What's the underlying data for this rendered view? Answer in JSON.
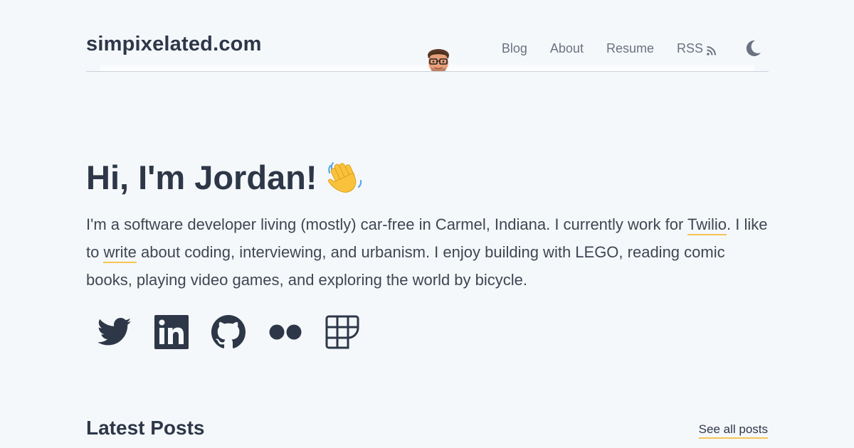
{
  "header": {
    "site_title": "simpixelated.com",
    "nav": [
      {
        "label": "Blog"
      },
      {
        "label": "About"
      },
      {
        "label": "Resume"
      },
      {
        "label": "RSS",
        "icon": "rss-icon"
      }
    ],
    "theme_toggle_icon": "moon-icon",
    "avatar_icon": "avatar-icon"
  },
  "hero": {
    "title": "Hi, I'm Jordan!",
    "emoji": "👋",
    "intro": {
      "part1": "I'm a software developer living (mostly) car-free in Carmel, Indiana. I currently work for ",
      "link1": "Twilio",
      "part2": ". I like to ",
      "link2": "write",
      "part3": " about coding, interviewing, and urbanism. I enjoy building with LEGO, reading comic books, playing video games, and exploring the world by bicycle."
    }
  },
  "social": [
    {
      "name": "twitter",
      "icon": "twitter-icon"
    },
    {
      "name": "linkedin",
      "icon": "linkedin-icon"
    },
    {
      "name": "github",
      "icon": "github-icon"
    },
    {
      "name": "flickr",
      "icon": "flickr-icon"
    },
    {
      "name": "grid",
      "icon": "grid-icon"
    }
  ],
  "latest": {
    "title": "Latest Posts",
    "see_all": "See all posts"
  },
  "colors": {
    "background": "#f5f8fb",
    "text": "#2d3748",
    "muted": "#6b7280",
    "link_underline": "#f6c453"
  }
}
